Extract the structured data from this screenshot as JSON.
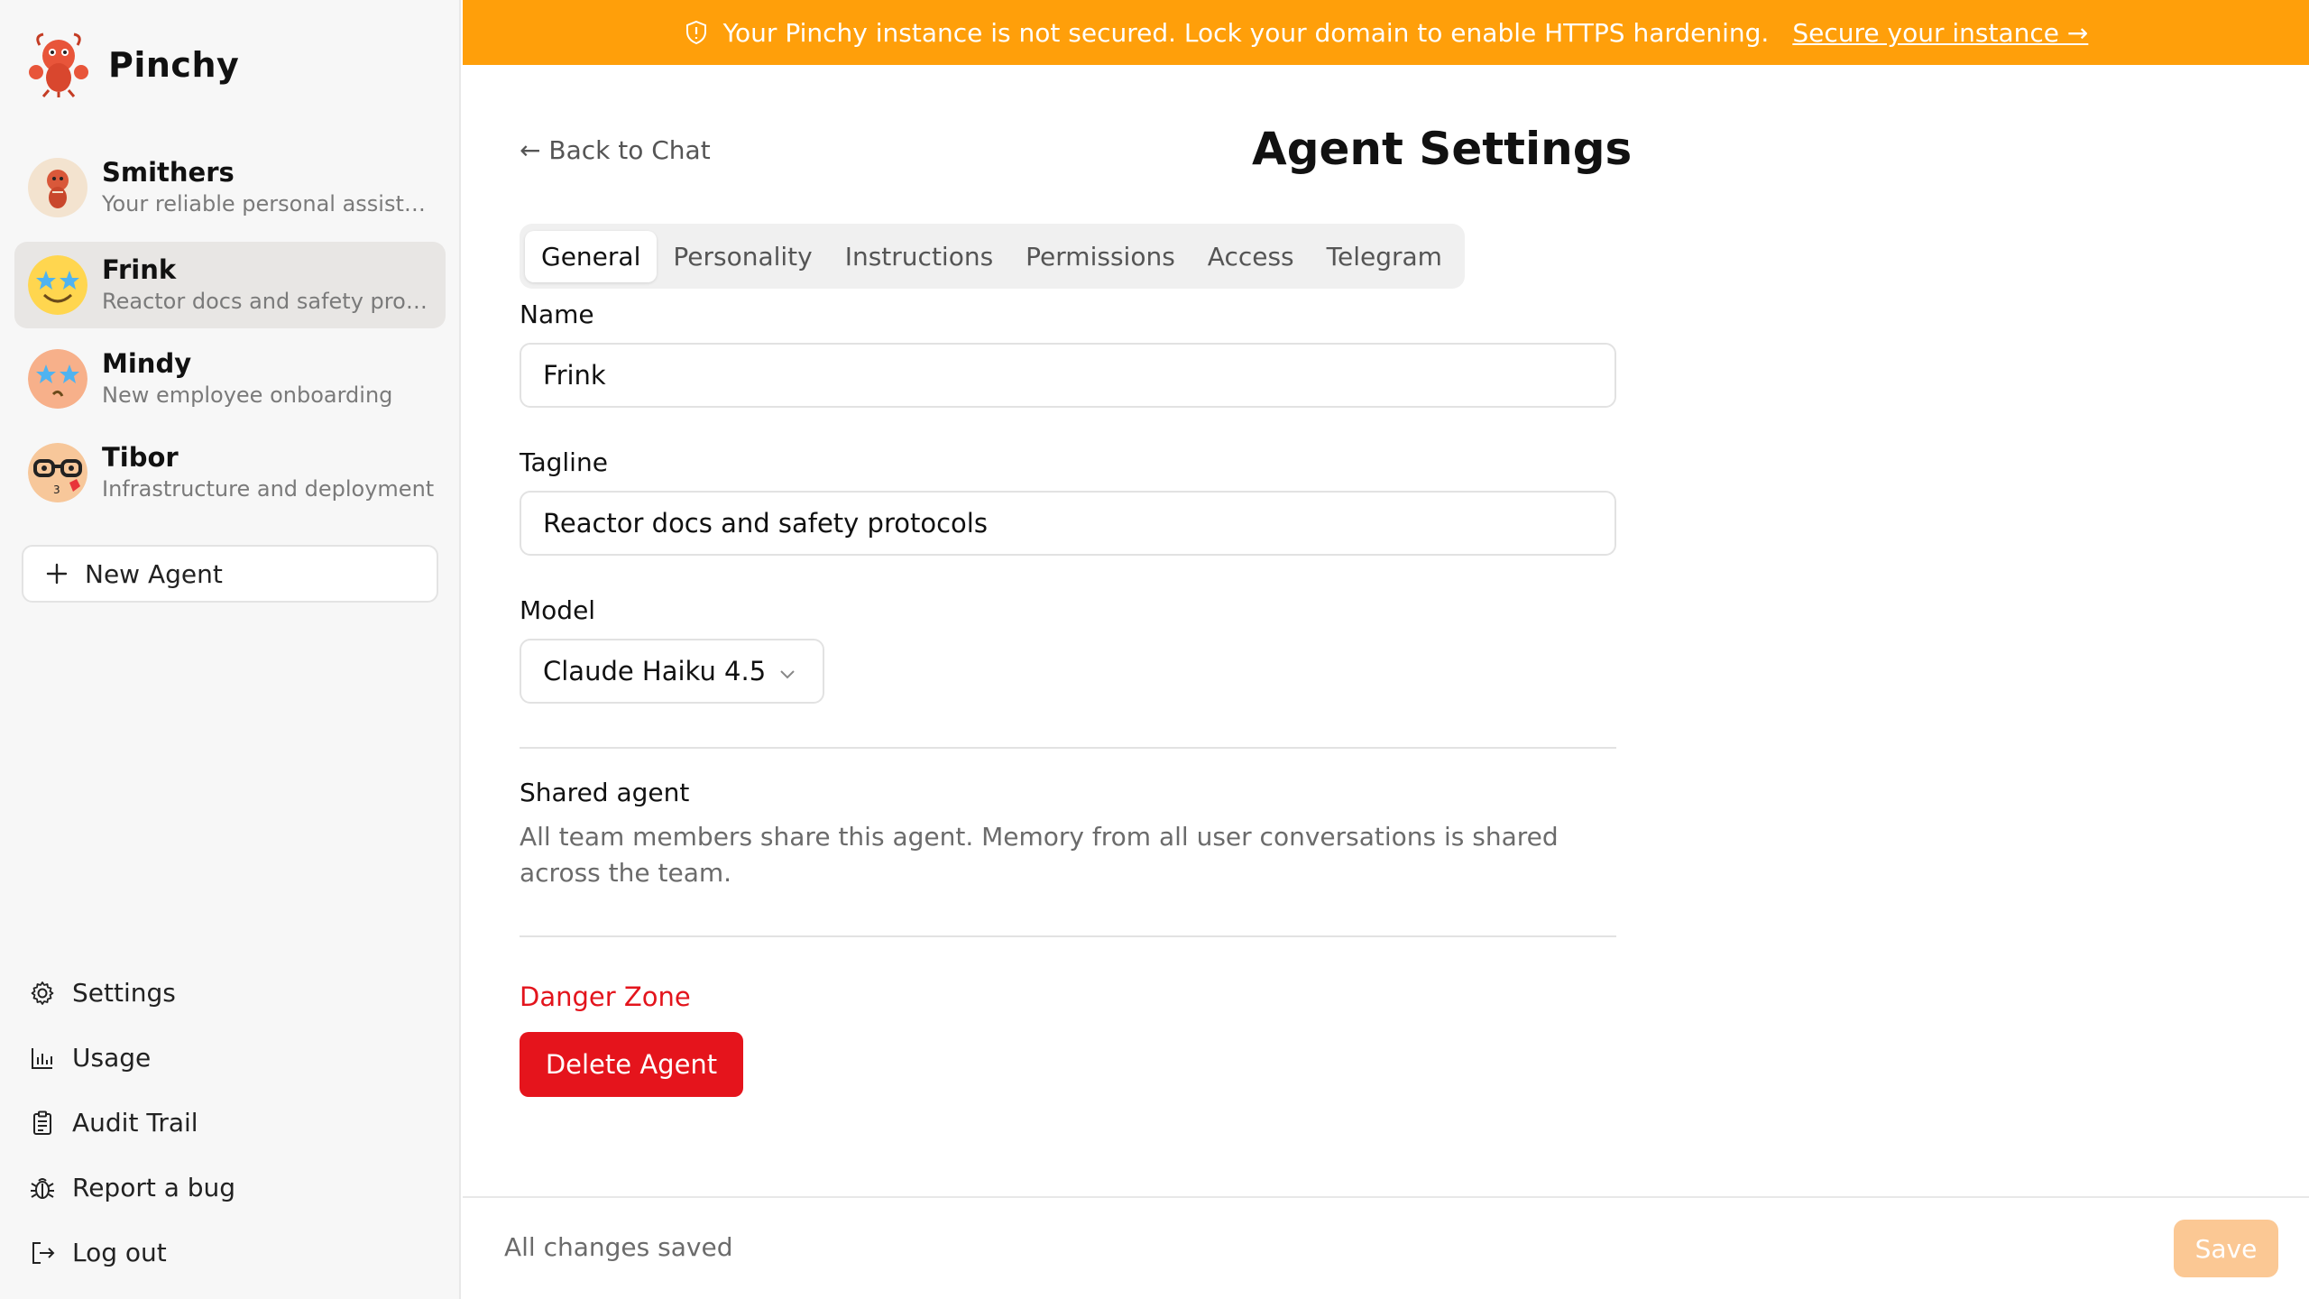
{
  "app": {
    "name": "Pinchy"
  },
  "banner": {
    "message": "Your Pinchy instance is not secured. Lock your domain to enable HTTPS hardening.",
    "link": "Secure your instance →",
    "color": "#ff9f0a"
  },
  "agents": [
    {
      "name": "Smithers",
      "tagline": "Your reliable personal assistant"
    },
    {
      "name": "Frink",
      "tagline": "Reactor docs and safety protocols",
      "active": true
    },
    {
      "name": "Mindy",
      "tagline": "New employee onboarding"
    },
    {
      "name": "Tibor",
      "tagline": "Infrastructure and deployment"
    }
  ],
  "sidebar": {
    "new_agent": "New Agent",
    "nav": [
      {
        "label": "Settings",
        "icon": "gear-icon"
      },
      {
        "label": "Usage",
        "icon": "bar-chart-icon"
      },
      {
        "label": "Audit Trail",
        "icon": "clipboard-icon"
      },
      {
        "label": "Report a bug",
        "icon": "bug-icon"
      },
      {
        "label": "Log out",
        "icon": "logout-icon"
      }
    ]
  },
  "page": {
    "back": "← Back to Chat",
    "title": "Agent Settings",
    "tabs": [
      "General",
      "Personality",
      "Instructions",
      "Permissions",
      "Access",
      "Telegram"
    ],
    "active_tab": "General"
  },
  "form": {
    "name_label": "Name",
    "name_value": "Frink",
    "tagline_label": "Tagline",
    "tagline_value": "Reactor docs and safety protocols",
    "model_label": "Model",
    "model_value": "Claude Haiku 4.5",
    "shared_title": "Shared agent",
    "shared_desc": "All team members share this agent. Memory from all user conversations is shared across the team.",
    "danger_title": "Danger Zone",
    "delete_label": "Delete Agent",
    "danger_color": "#e5141c"
  },
  "footer": {
    "status": "All changes saved",
    "save": "Save"
  }
}
